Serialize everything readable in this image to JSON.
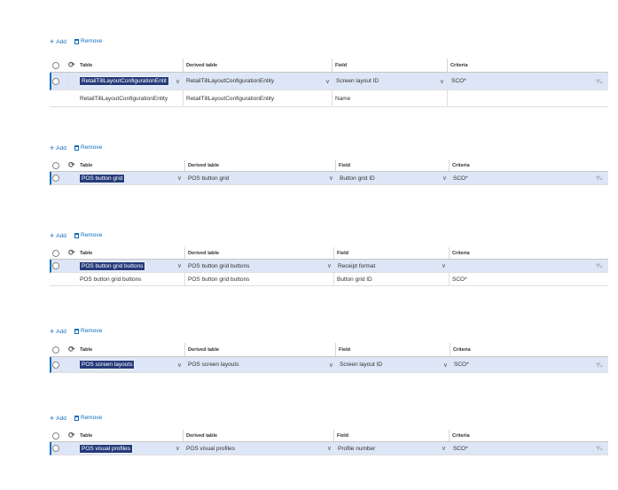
{
  "toolbar": {
    "add_label": "Add",
    "remove_label": "Remove"
  },
  "grids": [
    {
      "headers": [
        "Table",
        "Derived table",
        "Field",
        "Criteria"
      ],
      "rows": [
        {
          "table": "RetailTillLayoutConfigurationEntit",
          "derived": "RetailTillLayoutConfigurationEntity",
          "field": "Screen layout ID",
          "criteria": "SCO*"
        },
        {
          "table": "RetailTillLayoutConfigurationEntity",
          "derived": "RetailTillLayoutConfigurationEntity",
          "field": "Name",
          "criteria": ""
        }
      ]
    },
    {
      "headers": [
        "Table",
        "Derived table",
        "Field",
        "Criteria"
      ],
      "rows": [
        {
          "table": "POS button grid",
          "derived": "POS button grid",
          "field": "Button grid ID",
          "criteria": "SCO*"
        }
      ]
    },
    {
      "headers": [
        "Table",
        "Derived table",
        "Field",
        "Criteria"
      ],
      "rows": [
        {
          "table": "POS button grid buttons",
          "derived": "POS button grid buttons",
          "field": "Receipt format",
          "criteria": ""
        },
        {
          "table": "POS button grid buttons",
          "derived": "POS button grid buttons",
          "field": "Button grid ID",
          "criteria": "SCO*"
        }
      ]
    },
    {
      "headers": [
        "Table",
        "Derived table",
        "Field",
        "Criteria"
      ],
      "rows": [
        {
          "table": "POS screen layouts",
          "derived": "POS screen layouts",
          "field": "Screen layout ID",
          "criteria": "SCO*"
        }
      ]
    },
    {
      "headers": [
        "Table",
        "Derived table",
        "Field",
        "Criteria"
      ],
      "rows": [
        {
          "table": "POS visual profiles",
          "derived": "POS visual profiles",
          "field": "Profile number",
          "criteria": "SCO*"
        }
      ]
    }
  ]
}
